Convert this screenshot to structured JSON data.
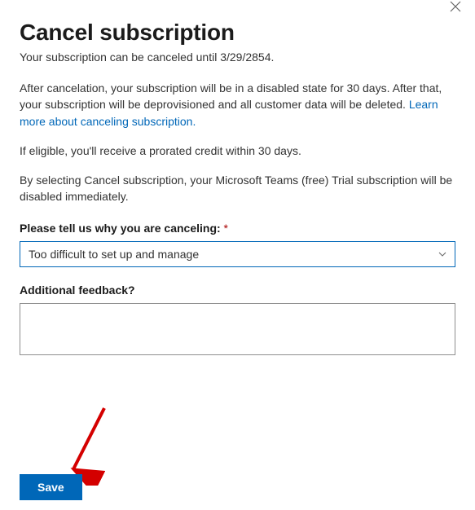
{
  "header": {
    "title": "Cancel subscription",
    "subtitle": "Your subscription can be canceled until 3/29/2854."
  },
  "body": {
    "p1_a": "After cancelation, your subscription will be in a disabled state for 30 days. After that, your subscription will be deprovisioned and all customer data will be deleted. ",
    "p1_link": "Learn more about canceling subscription.",
    "p2": "If eligible, you'll receive a prorated credit within 30 days.",
    "p3": "By selecting Cancel subscription, your Microsoft Teams (free) Trial subscription will be disabled immediately."
  },
  "form": {
    "reason_label": "Please tell us why you are canceling:",
    "required_mark": "*",
    "reason_value": "Too difficult to set up and manage",
    "feedback_label": "Additional feedback?",
    "feedback_value": ""
  },
  "footer": {
    "save_label": "Save"
  }
}
